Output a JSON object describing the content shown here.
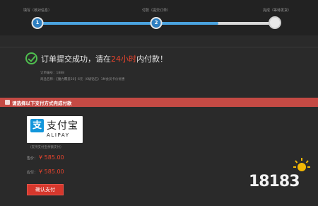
{
  "progress": {
    "steps": [
      {
        "label": "填写（核对信息）",
        "number": "1"
      },
      {
        "label": "付款（提交订单）",
        "number": "2"
      },
      {
        "label": "完成（等待发货）",
        "number": ""
      }
    ],
    "progress_fraction": 0.76
  },
  "success": {
    "text_before": "订单提交成功，请在",
    "highlight": "24小时",
    "text_after": "内付款！",
    "order_no_line": "订单编号：1888",
    "product_line": "商品名称：【魔力覆盖50】6元（0级钻石）1M会员卡价优惠"
  },
  "payment": {
    "bar_label": "请选择以下支付方式完成付款",
    "alipay_cn": "支付宝",
    "alipay_en": "ALIPAY",
    "alipay_note": "（支持支付宝余额支付）",
    "price_label": "售价：",
    "price_value": "¥ 585.00",
    "total_label": "应付：",
    "total_value": "¥ 585.00",
    "confirm_label": "确认支付"
  },
  "watermark": {
    "text": "18183"
  },
  "colors": {
    "accent_blue": "#2e7fc1",
    "highlight_red": "#e8442d",
    "bar_red": "#c44a44",
    "success_green": "#4fbf4f"
  }
}
